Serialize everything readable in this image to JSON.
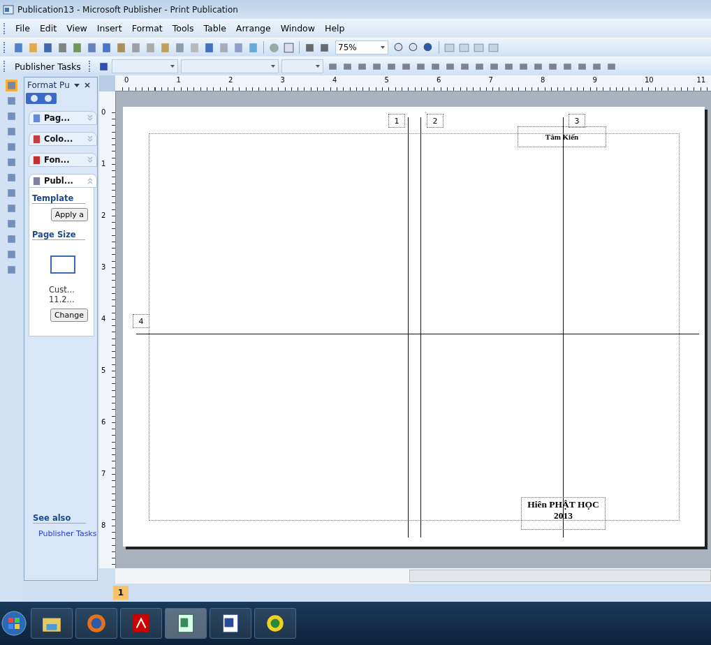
{
  "window": {
    "title": "Publication13 - Microsoft Publisher - Print Publication"
  },
  "menu": [
    {
      "label": "File"
    },
    {
      "label": "Edit"
    },
    {
      "label": "View"
    },
    {
      "label": "Insert"
    },
    {
      "label": "Format"
    },
    {
      "label": "Tools"
    },
    {
      "label": "Table"
    },
    {
      "label": "Arrange"
    },
    {
      "label": "Window"
    },
    {
      "label": "Help"
    }
  ],
  "standard_toolbar": {
    "zoom": "75%"
  },
  "formatting_toolbar": {
    "tasks_button": "Publisher Tasks"
  },
  "task_pane": {
    "title": "Format Pu",
    "sections": [
      {
        "label": "Pag...",
        "expanded": false
      },
      {
        "label": "Colo...",
        "expanded": false
      },
      {
        "label": "Fon...",
        "expanded": false
      },
      {
        "label": "Publ...",
        "expanded": true
      }
    ],
    "template_heading": "Template",
    "apply_button": "Apply a",
    "page_size_heading": "Page Size",
    "page_size_lines": [
      "Cust...",
      "11.2..."
    ],
    "change_button": "Change",
    "see_also_heading": "See also",
    "see_also_link": "Publisher Tasks"
  },
  "horizontal_ruler": [
    "0",
    "1",
    "2",
    "3",
    "4",
    "5",
    "6",
    "7",
    "8",
    "9",
    "10",
    "11"
  ],
  "vertical_ruler": [
    "0",
    "1",
    "2",
    "3",
    "4",
    "5",
    "6",
    "7",
    "8"
  ],
  "page": {
    "guide_labels": [
      "1",
      "2",
      "3",
      "4"
    ],
    "top_text": "Tâm Kiến",
    "bottom_text": [
      "Hiên PHẬT HỌC",
      "2013"
    ]
  },
  "page_tabs": [
    {
      "label": "1",
      "selected": true
    }
  ]
}
